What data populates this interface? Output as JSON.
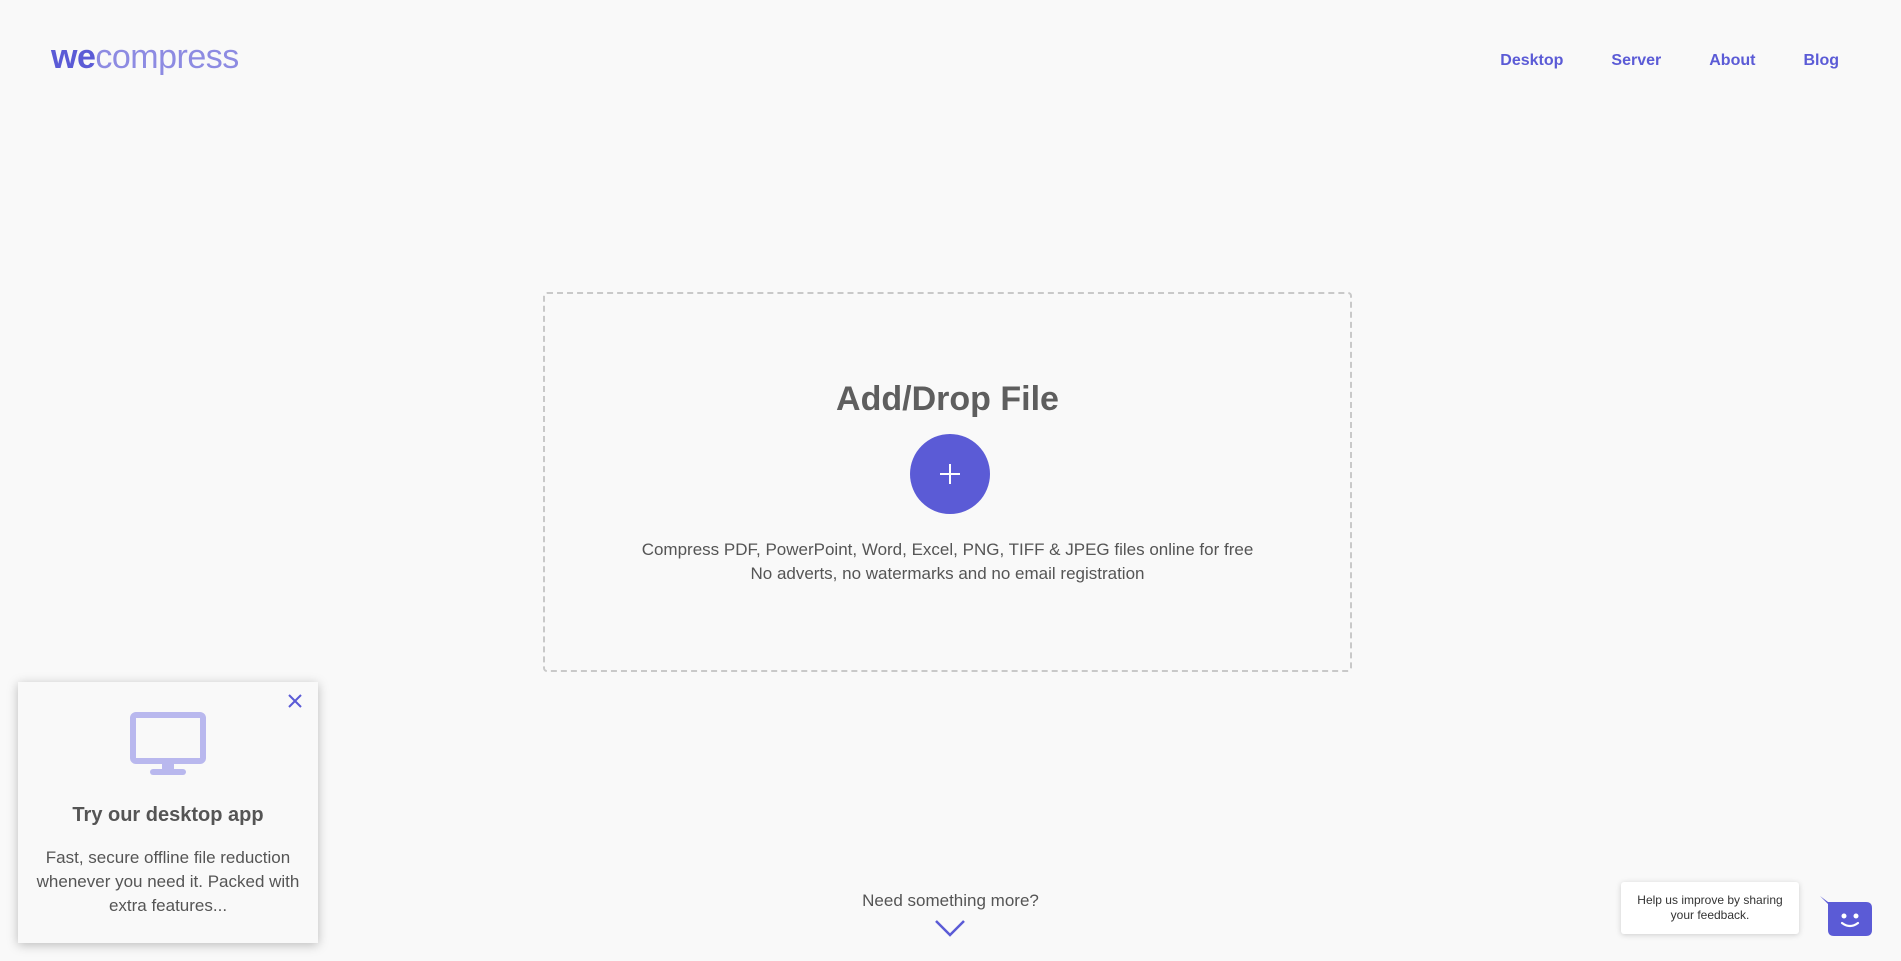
{
  "header": {
    "logo_bold": "we",
    "logo_light": "compress",
    "nav": [
      {
        "label": "Desktop"
      },
      {
        "label": "Server"
      },
      {
        "label": "About"
      },
      {
        "label": "Blog"
      }
    ]
  },
  "dropzone": {
    "title": "Add/Drop File",
    "add_icon": "plus-icon",
    "line1": "Compress PDF, PowerPoint, Word, Excel, PNG, TIFF & JPEG files online for free",
    "line2": "No adverts, no watermarks and no email registration"
  },
  "more": {
    "label": "Need something more?",
    "icon": "chevron-down-icon"
  },
  "popup": {
    "icon": "monitor-icon",
    "close_icon": "close-icon",
    "title": "Try our desktop app",
    "description": "Fast, secure offline file reduction whenever you need it. Packed with extra features..."
  },
  "feedback": {
    "text": "Help us improve by sharing your feedback.",
    "icon": "chat-face-icon"
  },
  "colors": {
    "accent": "#5b5bd6",
    "accent_light": "#8d8be2",
    "monitor_icon": "#b9b8ee",
    "background": "#f9f9f9",
    "text": "#555555"
  }
}
